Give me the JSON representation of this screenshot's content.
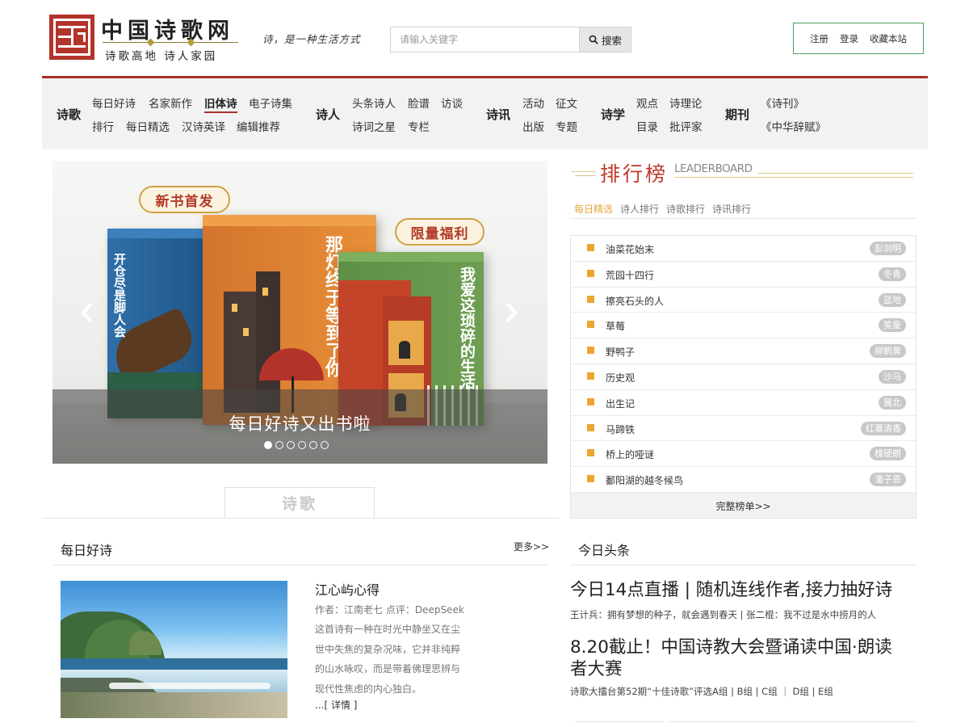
{
  "header": {
    "logo_title": "中国诗歌网",
    "logo_subtitle": "诗歌高地 诗人家园",
    "slogan": "诗，是一种生活方式",
    "search": {
      "placeholder": "请输入关键字",
      "button_label": "搜索"
    },
    "user_links": {
      "register": "注册",
      "login": "登录",
      "bookmark": "收藏本站"
    }
  },
  "nav": {
    "groups": [
      {
        "title": "诗歌",
        "items": [
          "每日好诗",
          "名家新作",
          "旧体诗",
          "电子诗集",
          "排行",
          "每日精选",
          "汉诗英译",
          "编辑推荐"
        ],
        "active": "旧体诗"
      },
      {
        "title": "诗人",
        "items": [
          "头条诗人",
          "脸谱",
          "访谈",
          "诗词之星",
          "专栏"
        ]
      },
      {
        "title": "诗讯",
        "items": [
          "活动",
          "征文",
          "出版",
          "专题"
        ]
      },
      {
        "title": "诗学",
        "items": [
          "观点",
          "诗理论",
          "目录",
          "批评家"
        ]
      },
      {
        "title": "期刊",
        "items": [
          "《诗刊》",
          "《中华辞赋》"
        ]
      }
    ]
  },
  "banner": {
    "tag_left": "新书首发",
    "tag_right": "限量福利",
    "book_titles": [
      "开仓尽是脚人会",
      "那灯终于等到了你",
      "我爱这琐碎的生活"
    ],
    "caption": "每日好诗又出书啦",
    "slide_count": 6,
    "active_slide": 1
  },
  "poem_tab": "诗歌",
  "leaderboard": {
    "title": "排行榜",
    "title_en": "LEADERBOARD",
    "tabs": [
      "每日精选",
      "诗人排行",
      "诗歌排行",
      "诗讯排行"
    ],
    "active_tab": "每日精选",
    "rows": [
      {
        "name": "油菜花始末",
        "author": "彭剑明"
      },
      {
        "name": "荒园十四行",
        "author": "冬青"
      },
      {
        "name": "擦亮石头的人",
        "author": "蓝地"
      },
      {
        "name": "草莓",
        "author": "笑童"
      },
      {
        "name": "野鸭子",
        "author": "柳鹅黄"
      },
      {
        "name": "历史观",
        "author": "沙马"
      },
      {
        "name": "出生记",
        "author": "冀北"
      },
      {
        "name": "马蹄铁",
        "author": "红薯清香"
      },
      {
        "name": "桥上的哑谜",
        "author": "槐硬朗"
      },
      {
        "name": "鄱阳湖的越冬候鸟",
        "author": "潘子恩"
      }
    ],
    "more_label": "完整榜单>>"
  },
  "daily_poem": {
    "section_title": "每日好诗",
    "more_label": "更多>>",
    "title": "江心屿心得",
    "meta": "作者：江南老七 点评：DeepSeek",
    "body": "这首诗有一种在时光中静坐又在尘世中失焦的复杂况味，它并非纯粹的山水咏叹，而是带着佛理思辨与现代性焦虑的内心独白。",
    "detail_label": "...[ 详情 ]"
  },
  "headlines": {
    "section_title": "今日头条",
    "items": [
      {
        "title": "今日14点直播 | 随机连线作者,接力抽好诗",
        "sub": "王计兵：拥有梦想的种子，就会遇到春天 | 张二棍：我不过是水中捞月的人"
      },
      {
        "title": "8.20截止！中国诗教大会暨诵读中国·朗读者大赛",
        "sub": "诗歌大擂台第52期“十佳诗歌”评选A组 | B组 | C组 ｜ D组 | E组"
      }
    ]
  },
  "colors": {
    "brand_red": "#a8302b",
    "leaderboard_accent": "#eea530",
    "user_box_border": "#4d9e5b"
  }
}
